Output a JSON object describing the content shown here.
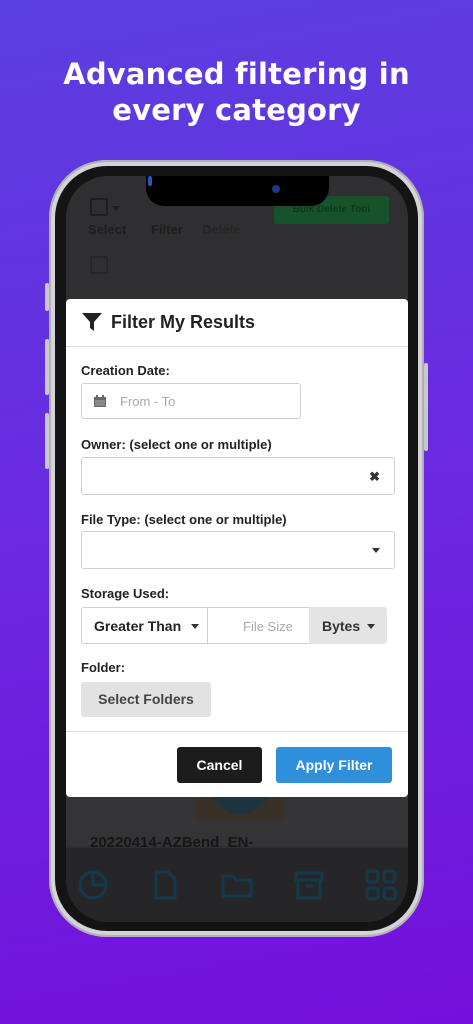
{
  "headline": {
    "line1": "Advanced filtering in",
    "line2": "every category"
  },
  "background_app": {
    "toolbar": {
      "select_label": "Select",
      "filter_label": "Filter",
      "delete_label": "Delete",
      "bulk_delete_label": "Bulk Delete Tool"
    },
    "file_name": "20220414-AZBend_EN-",
    "tabs": [
      "dashboard-icon",
      "file-icon",
      "folder-icon",
      "archive-icon",
      "grid-icon"
    ]
  },
  "modal": {
    "title": "Filter My Results",
    "creation_date": {
      "label": "Creation Date:",
      "placeholder": "From - To"
    },
    "owner": {
      "label": "Owner: (select one or multiple)",
      "clear_icon": "✖"
    },
    "file_type": {
      "label": "File Type: (select one or multiple)"
    },
    "storage": {
      "label": "Storage Used:",
      "comparator": "Greater Than",
      "size_placeholder": "File Size",
      "unit": "Bytes"
    },
    "folder": {
      "label": "Folder:",
      "button": "Select Folders"
    },
    "cancel_label": "Cancel",
    "apply_label": "Apply Filter"
  },
  "colors": {
    "accent": "#2e8fdc",
    "dark_button": "#1c1c1c",
    "background": "#6a2be0"
  }
}
